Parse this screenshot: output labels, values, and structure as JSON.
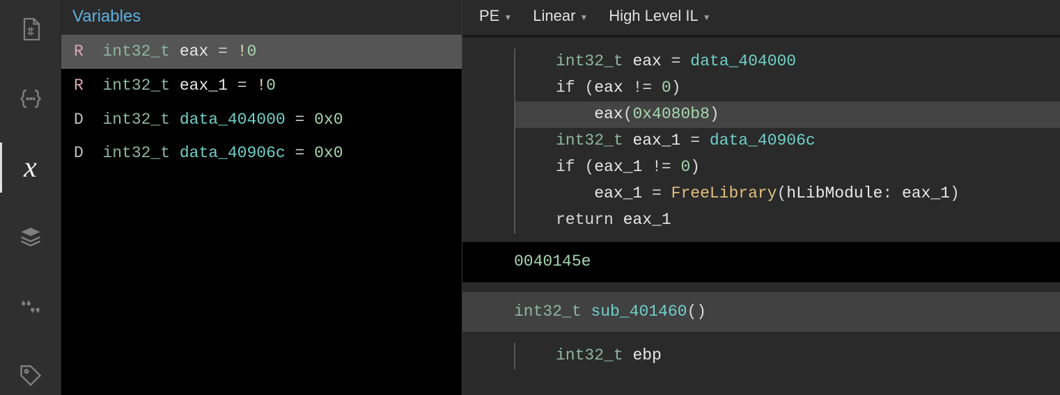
{
  "sidebar": {
    "icons": [
      "hash-file",
      "braces",
      "x-var",
      "layers",
      "quotes",
      "tag"
    ],
    "activeIndex": 2
  },
  "variables": {
    "title": "Variables",
    "rows": [
      {
        "prefix": "R",
        "type": "int32_t",
        "name": "eax",
        "nameColor": "w",
        "eq": "=",
        "bang": "!",
        "value": "0",
        "selected": true
      },
      {
        "prefix": "R",
        "type": "int32_t",
        "name": "eax_1",
        "nameColor": "w",
        "eq": "=",
        "bang": "!",
        "value": "0",
        "selected": false
      },
      {
        "prefix": "D",
        "type": "int32_t",
        "name": "data_404000",
        "nameColor": "c",
        "eq": "=",
        "bang": "",
        "value": "0x0",
        "selected": false
      },
      {
        "prefix": "D",
        "type": "int32_t",
        "name": "data_40906c",
        "nameColor": "c",
        "eq": "=",
        "bang": "",
        "value": "0x0",
        "selected": false
      }
    ]
  },
  "toolbar": {
    "pe": "PE",
    "linear": "Linear",
    "hlil": "High Level IL"
  },
  "code": {
    "l1": {
      "type": "int32_t",
      "name": "eax",
      "eq": " = ",
      "ref": "data_404000"
    },
    "l2": {
      "kw": "if ",
      "open": "(",
      "v": "eax",
      "cmp": " != ",
      "z": "0",
      "close": ")"
    },
    "l3": {
      "call": "eax",
      "open": "(",
      "arg": "0x4080b8",
      "close": ")"
    },
    "l4": {
      "type": "int32_t",
      "name": "eax_1",
      "eq": " = ",
      "ref": "data_40906c"
    },
    "l5": {
      "kw": "if ",
      "open": "(",
      "v": "eax_1",
      "cmp": " != ",
      "z": "0",
      "close": ")"
    },
    "l6": {
      "lhs": "eax_1",
      "eq": " = ",
      "fn": "FreeLibrary",
      "open": "(",
      "argk": "hLibModule",
      "colon": ": ",
      "argv": "eax_1",
      "close": ")"
    },
    "l7": {
      "kw": "return ",
      "v": "eax_1"
    },
    "addr": "0040145e",
    "sig": {
      "type": "int32_t",
      "name": "sub_401460",
      "parens": "()"
    },
    "last": {
      "type": "int32_t",
      "name": "ebp"
    }
  }
}
